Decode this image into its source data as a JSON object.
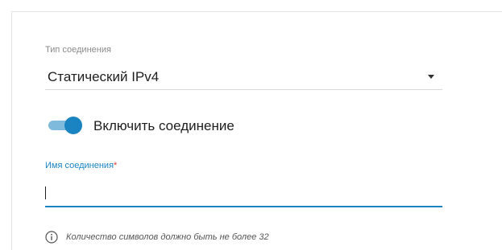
{
  "connection_type": {
    "label": "Тип соединения",
    "value": "Статический IPv4",
    "icon": "chevron-down-icon"
  },
  "enable_connection": {
    "label": "Включить соединение",
    "checked": true,
    "accent_color": "#1a84c2"
  },
  "connection_name": {
    "label": "Имя соединения",
    "required_mark": "*",
    "value": "",
    "placeholder": ""
  },
  "hint": {
    "icon": "info-icon",
    "text": "Количество символов должно быть не более 32"
  }
}
